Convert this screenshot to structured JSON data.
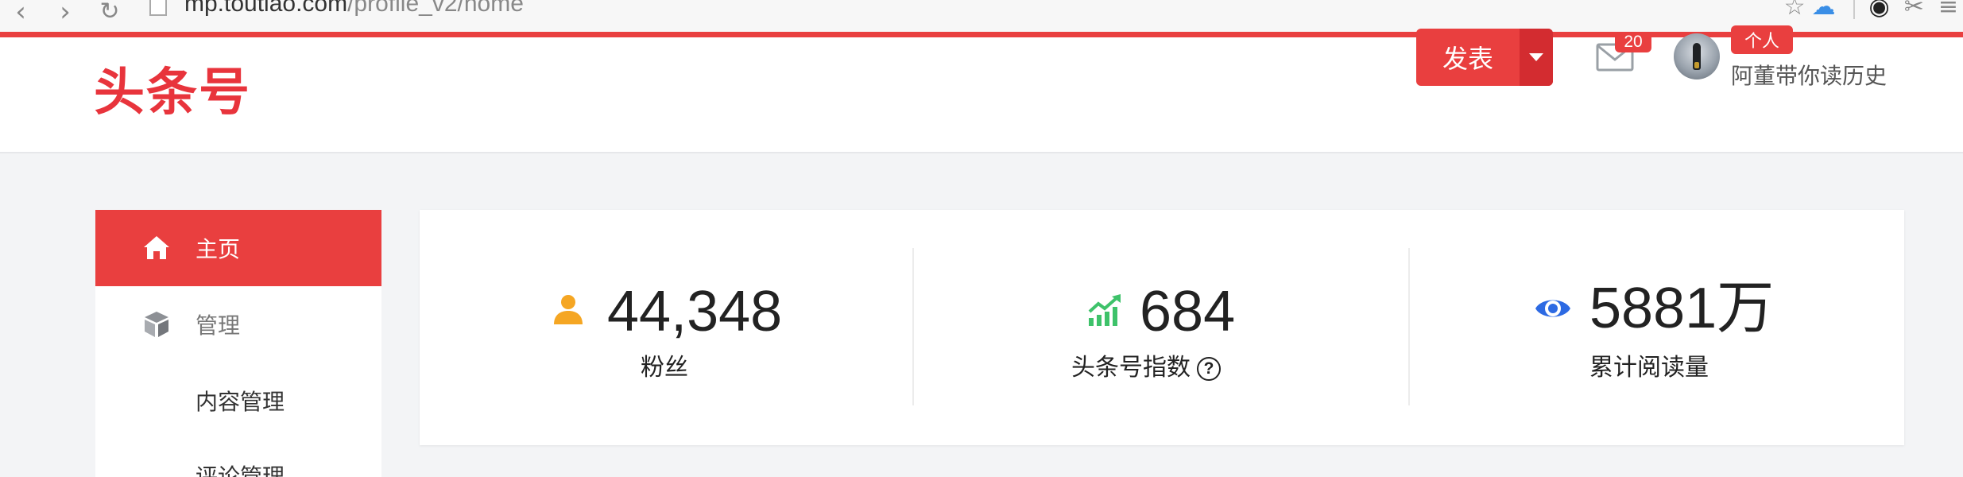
{
  "browser": {
    "url_host": "mp.toutiao.com",
    "url_path": "/profile_v2/home"
  },
  "header": {
    "logo": "头条号",
    "publish_label": "发表",
    "mail_count": "20",
    "role_badge": "个人",
    "username": "阿董带你读历史"
  },
  "sidebar": {
    "items": [
      {
        "label": "主页"
      },
      {
        "label": "管理"
      },
      {
        "label": "内容管理"
      },
      {
        "label": "评论管理"
      }
    ]
  },
  "stats": [
    {
      "value": "44,348",
      "label": "粉丝",
      "icon": "user-icon",
      "color": "#f5a623"
    },
    {
      "value": "684",
      "label": "头条号指数",
      "icon": "trend-up-icon",
      "color": "#3ec26a"
    },
    {
      "value": "5881万",
      "label": "累计阅读量",
      "icon": "eye-icon",
      "color": "#2d6ae3"
    }
  ],
  "colors": {
    "brand": "#e93f3f",
    "background": "#f3f4f6"
  }
}
